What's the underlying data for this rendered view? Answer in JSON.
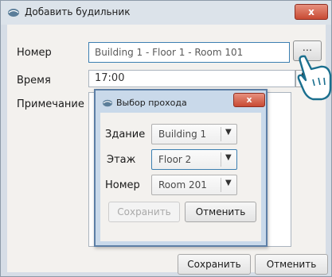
{
  "window": {
    "title": "Добавить будильник",
    "close_label": "x"
  },
  "form": {
    "number_label": "Номер",
    "number_value": "Building 1 - Floor 1 - Room 101",
    "ellipsis_label": "...",
    "time_label": "Время",
    "time_value": "17:00",
    "note_label": "Примечание",
    "save_label": "Сохранить",
    "cancel_label": "Отменить"
  },
  "dialog": {
    "title": "Выбор прохода",
    "close_label": "x",
    "building_label": "Здание",
    "building_value": "Building 1",
    "floor_label": "Этаж",
    "floor_value": "Floor 2",
    "room_label": "Номер",
    "room_value": "Room 201",
    "save_label": "Сохранить",
    "cancel_label": "Отменить"
  },
  "colors": {
    "accent_border": "#3c7fb1",
    "close_red": "#c84a33",
    "dialog_frame": "#c9d9ea"
  }
}
